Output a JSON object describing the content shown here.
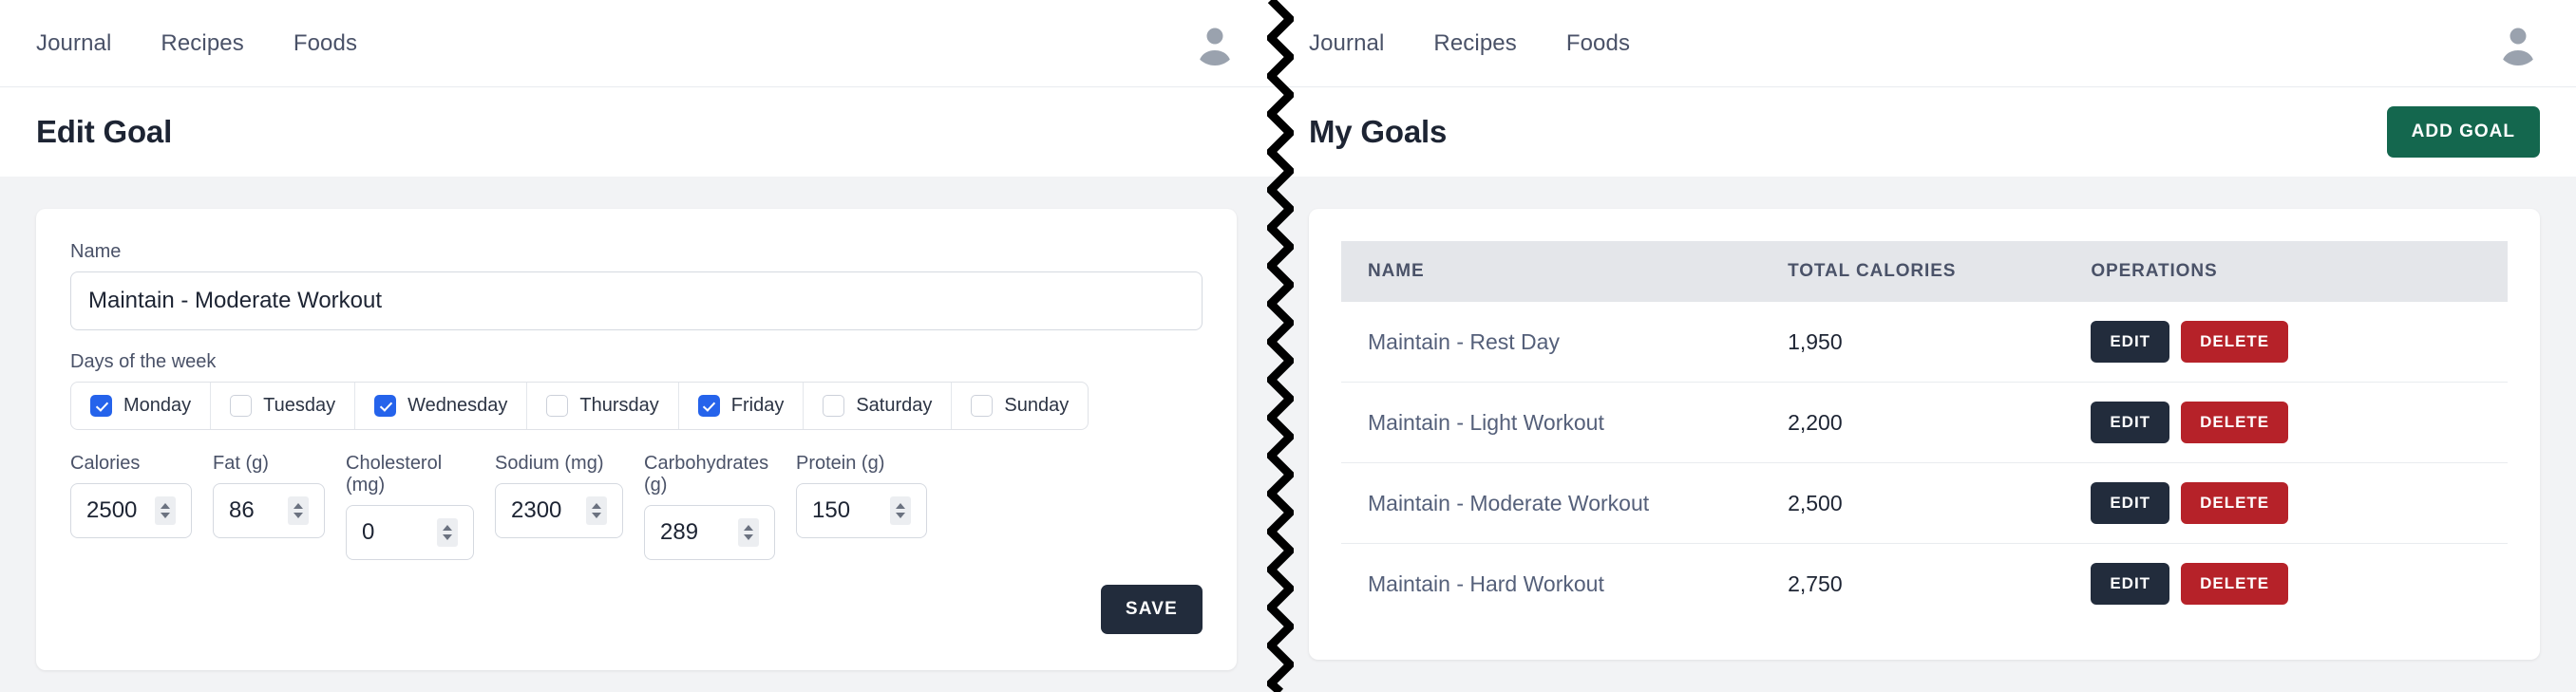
{
  "nav": {
    "links": [
      "Journal",
      "Recipes",
      "Foods"
    ],
    "avatar_icon": "user-avatar-icon"
  },
  "left_panel": {
    "page_title": "Edit Goal",
    "form": {
      "name_label": "Name",
      "name_value": "Maintain - Moderate Workout",
      "name_placeholder": "Name",
      "days_label": "Days of the week",
      "days": [
        {
          "label": "Monday",
          "checked": true
        },
        {
          "label": "Tuesday",
          "checked": false
        },
        {
          "label": "Wednesday",
          "checked": true
        },
        {
          "label": "Thursday",
          "checked": false
        },
        {
          "label": "Friday",
          "checked": true
        },
        {
          "label": "Saturday",
          "checked": false
        },
        {
          "label": "Sunday",
          "checked": false
        }
      ],
      "numbers": [
        {
          "label": "Calories",
          "value": "2500",
          "width": 128
        },
        {
          "label": "Fat (g)",
          "value": "86",
          "width": 118
        },
        {
          "label": "Cholesterol (mg)",
          "value": "0",
          "width": 135
        },
        {
          "label": "Sodium (mg)",
          "value": "2300",
          "width": 135
        },
        {
          "label": "Carbohydrates (g)",
          "value": "289",
          "width": 138
        },
        {
          "label": "Protein (g)",
          "value": "150",
          "width": 138
        }
      ],
      "save_label": "SAVE"
    }
  },
  "right_panel": {
    "page_title": "My Goals",
    "add_goal_label": "ADD GOAL",
    "table": {
      "headers": [
        "NAME",
        "TOTAL CALORIES",
        "OPERATIONS"
      ],
      "rows": [
        {
          "name": "Maintain - Rest Day",
          "calories": "1,950",
          "edit": "EDIT",
          "delete": "DELETE"
        },
        {
          "name": "Maintain - Light Workout",
          "calories": "2,200",
          "edit": "EDIT",
          "delete": "DELETE"
        },
        {
          "name": "Maintain - Moderate Workout",
          "calories": "2,500",
          "edit": "EDIT",
          "delete": "DELETE"
        },
        {
          "name": "Maintain - Hard Workout",
          "calories": "2,750",
          "edit": "EDIT",
          "delete": "DELETE"
        }
      ]
    }
  },
  "colors": {
    "accent_green": "#14674e",
    "navy": "#222c3c",
    "danger_red": "#b62229",
    "checkbox_blue": "#2563eb",
    "page_bg": "#f2f3f5"
  }
}
